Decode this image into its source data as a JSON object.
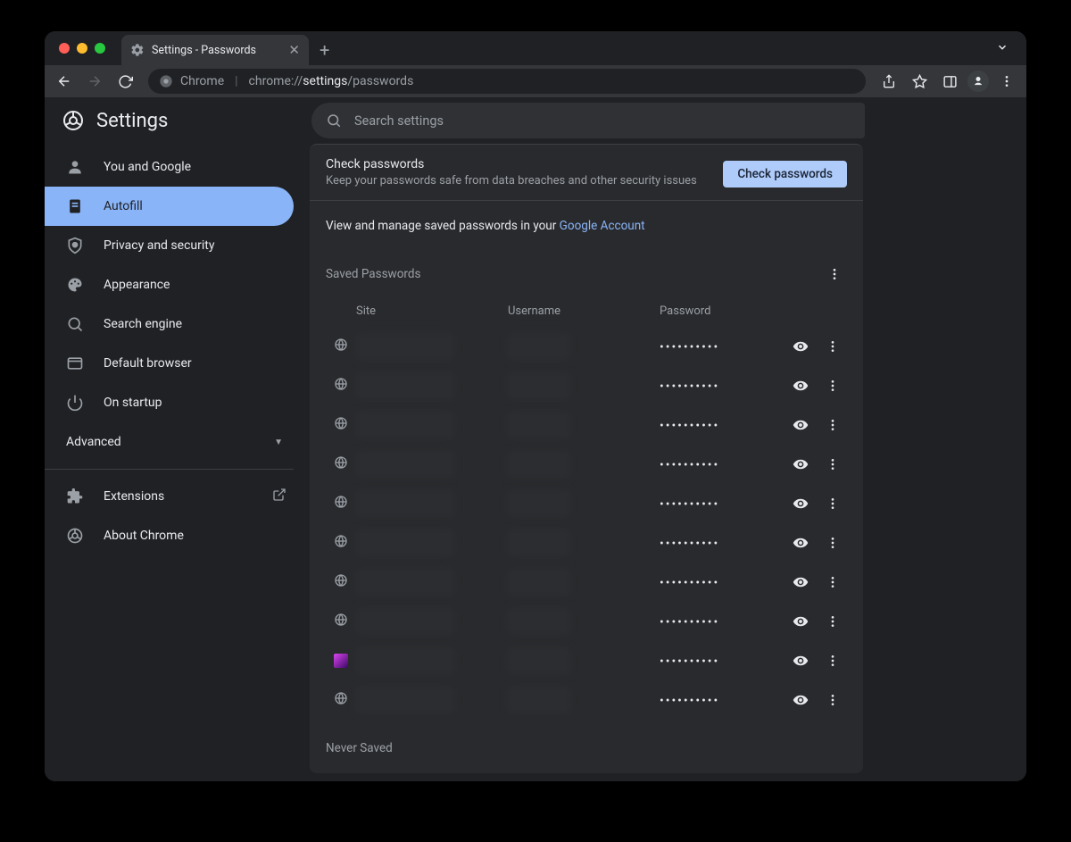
{
  "tab": {
    "title": "Settings - Passwords"
  },
  "omnibox": {
    "product": "Chrome",
    "base": "chrome://",
    "bold": "settings",
    "rest": "/passwords"
  },
  "header": {
    "title": "Settings"
  },
  "search": {
    "placeholder": "Search settings"
  },
  "sidebar": {
    "items": [
      {
        "label": "You and Google",
        "icon": "person"
      },
      {
        "label": "Autofill",
        "icon": "autofill",
        "selected": true
      },
      {
        "label": "Privacy and security",
        "icon": "shield"
      },
      {
        "label": "Appearance",
        "icon": "palette"
      },
      {
        "label": "Search engine",
        "icon": "search"
      },
      {
        "label": "Default browser",
        "icon": "browser"
      },
      {
        "label": "On startup",
        "icon": "power"
      }
    ],
    "advanced": "Advanced",
    "footer": [
      {
        "label": "Extensions",
        "icon": "puzzle",
        "external": true
      },
      {
        "label": "About Chrome",
        "icon": "chrome"
      }
    ]
  },
  "check": {
    "title": "Check passwords",
    "subtitle": "Keep your passwords safe from data breaches and other security issues",
    "button": "Check passwords"
  },
  "google_account": {
    "prefix": "View and manage saved passwords in your ",
    "link": "Google Account"
  },
  "saved_section": {
    "title": "Saved Passwords"
  },
  "columns": {
    "site": "Site",
    "username": "Username",
    "password": "Password"
  },
  "passwords": [
    {
      "masked": "••••••••••",
      "favicon": "globe"
    },
    {
      "masked": "••••••••••",
      "favicon": "globe"
    },
    {
      "masked": "••••••••••",
      "favicon": "globe"
    },
    {
      "masked": "••••••••••",
      "favicon": "globe"
    },
    {
      "masked": "••••••••••",
      "favicon": "globe"
    },
    {
      "masked": "••••••••••",
      "favicon": "globe"
    },
    {
      "masked": "••••••••••",
      "favicon": "globe"
    },
    {
      "masked": "••••••••••",
      "favicon": "globe"
    },
    {
      "masked": "••••••••••",
      "favicon": "colored"
    },
    {
      "masked": "••••••••••",
      "favicon": "globe"
    }
  ],
  "never_saved": {
    "title": "Never Saved"
  }
}
